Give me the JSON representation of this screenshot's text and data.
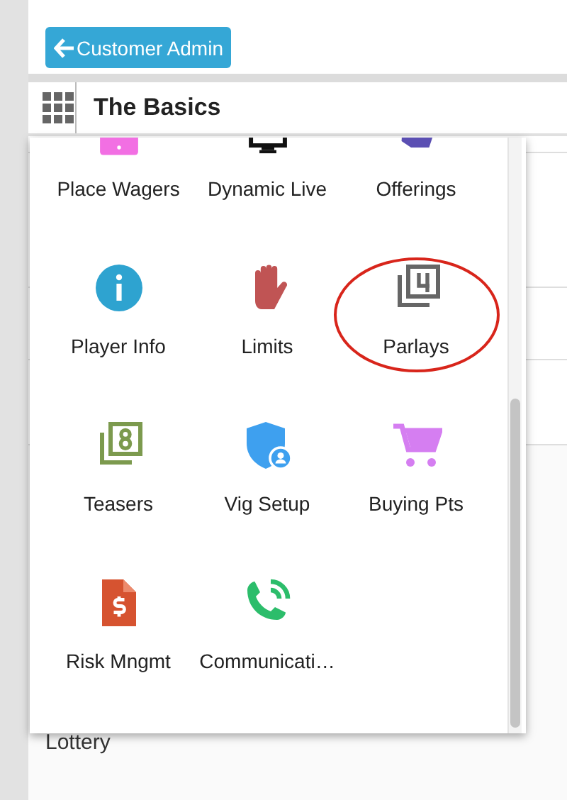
{
  "back_button": {
    "label": "Customer Admin"
  },
  "section": {
    "title": "The Basics"
  },
  "menu": {
    "items": [
      {
        "label": "Place Wagers",
        "highlighted": false
      },
      {
        "label": "Dynamic Live",
        "highlighted": false
      },
      {
        "label": "Offerings",
        "highlighted": false
      },
      {
        "label": "Player Info",
        "highlighted": false
      },
      {
        "label": "Limits",
        "highlighted": false
      },
      {
        "label": "Parlays",
        "highlighted": true
      },
      {
        "label": "Teasers",
        "highlighted": false
      },
      {
        "label": "Vig Setup",
        "highlighted": false
      },
      {
        "label": "Buying Pts",
        "highlighted": false
      },
      {
        "label": "Risk Mngmt",
        "highlighted": false
      },
      {
        "label": "Communicati…",
        "highlighted": false
      }
    ]
  },
  "list": {
    "items": [
      {
        "label": "Lottery"
      }
    ]
  }
}
